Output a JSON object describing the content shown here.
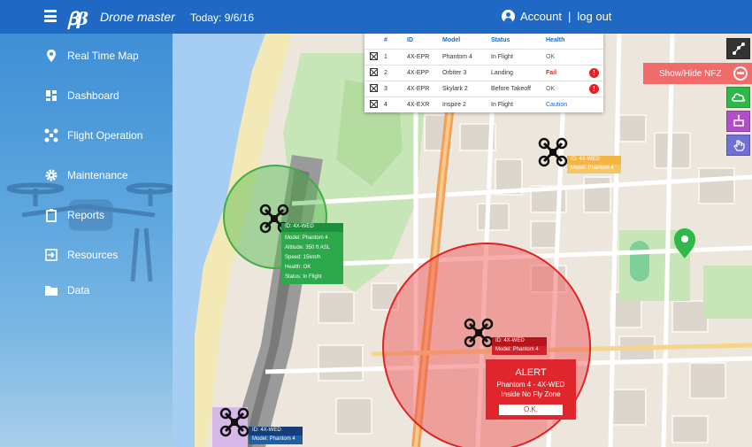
{
  "header": {
    "logo_mark": "ꞵβ",
    "brand": "Drone master",
    "today": "Today: 9/6/16",
    "account": "Account",
    "separator": "|",
    "logout": "log out"
  },
  "sidebar": {
    "items": [
      {
        "label": "Real Time Map",
        "icon": "map-pin-icon"
      },
      {
        "label": "Dashboard",
        "icon": "dashboard-grid-icon"
      },
      {
        "label": "Flight Operation",
        "icon": "drone-icon"
      },
      {
        "label": "Maintenance",
        "icon": "gear-icon"
      },
      {
        "label": "Reports",
        "icon": "clipboard-icon"
      },
      {
        "label": "Resources",
        "icon": "input-arrow-icon"
      },
      {
        "label": "Data",
        "icon": "folder-icon"
      }
    ]
  },
  "fleet_table": {
    "headers": [
      "#",
      "ID",
      "Model",
      "Status",
      "Health"
    ],
    "rows": [
      {
        "num": "1",
        "id": "4X-EPR",
        "model": "Phantom 4",
        "status": "In Flight",
        "health": "OK",
        "health_type": "ok",
        "alert": false
      },
      {
        "num": "2",
        "id": "4X-EPP",
        "model": "Orbiter 3",
        "status": "Landing",
        "health": "Fail",
        "health_type": "fail",
        "alert": true
      },
      {
        "num": "3",
        "id": "4X-EPR",
        "model": "Skylark 2",
        "status": "Before Takeoff",
        "health": "OK",
        "health_type": "ok",
        "alert": true
      },
      {
        "num": "4",
        "id": "4X-EXR",
        "model": "Inspire 2",
        "status": "In Flight",
        "health": "Caution",
        "health_type": "caution",
        "alert": false
      }
    ],
    "alert_glyph": "!"
  },
  "map_controls": {
    "nfz_label": "Show/Hide NFZ"
  },
  "drones": {
    "green": {
      "id": "ID: 4X-WED",
      "model": "Model: Phantom 4",
      "altitude": "Altitude: 350 ft ASL",
      "speed": "Speed: 15km/h",
      "health": "Health: OK",
      "status": "Status: In Flight"
    },
    "yellow": {
      "id": "ID: 4X-WED",
      "model": "Model: Phantom 4"
    },
    "red": {
      "id": "ID: 4X-WED",
      "model": "Model: Phantom 4"
    },
    "blue": {
      "id": "ID: 4X-WED",
      "model": "Model: Phantom 4"
    }
  },
  "alert": {
    "title": "ALERT",
    "line1": "Phantom 4 - 4X-WED",
    "line2": "Inside No Fly Zone",
    "ok_label": "O.K."
  },
  "colors": {
    "header": "#1f69c4",
    "nfz_red": "#e0262d",
    "safe_green": "#34a853",
    "caution_yellow": "#f2b33d",
    "info_blue": "#1f5fa8",
    "info_green": "#2da84a"
  }
}
